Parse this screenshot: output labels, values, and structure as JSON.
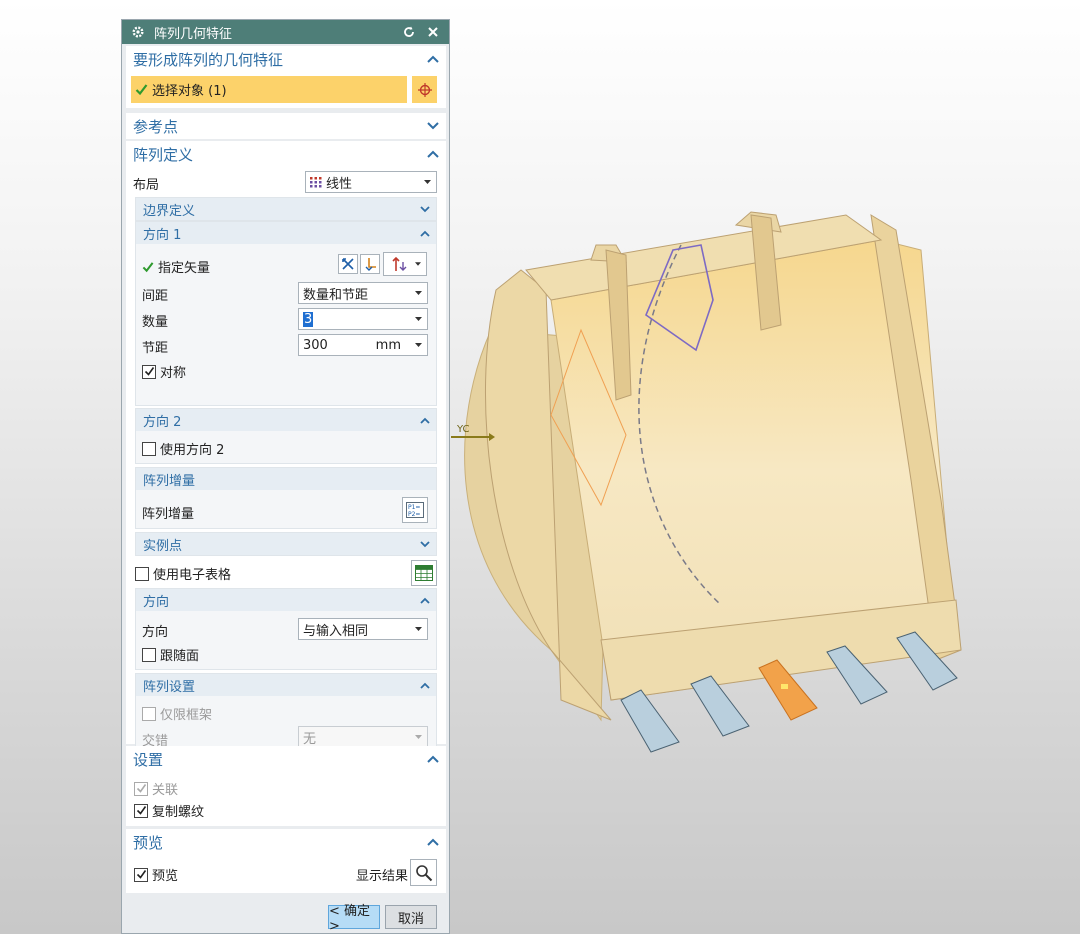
{
  "dialog": {
    "title": "阵列几何特征",
    "icons": {
      "settings": "gear-icon",
      "reset": "reset-icon",
      "close": "close-icon"
    }
  },
  "select_section": {
    "header": "要形成阵列的几何特征",
    "select_object": "选择对象 (1)"
  },
  "reference_point": {
    "header": "参考点"
  },
  "pattern_def": {
    "header": "阵列定义",
    "layout_label": "布局",
    "layout_value": "线性",
    "boundary_header": "边界定义",
    "direction1": {
      "header": "方向 1",
      "vector_label": "指定矢量",
      "spacing_label": "间距",
      "spacing_value": "数量和节距",
      "count_label": "数量",
      "count_value": "3",
      "pitch_label": "节距",
      "pitch_value": "300",
      "pitch_unit": "mm",
      "symmetric_label": "对称",
      "symmetric_checked": true
    },
    "direction2": {
      "header": "方向 2",
      "use_label": "使用方向 2",
      "use_checked": false
    },
    "increment": {
      "header": "阵列增量",
      "label": "阵列增量"
    },
    "instance_header": "实例点",
    "spreadsheet_label": "使用电子表格",
    "orientation": {
      "header": "方向",
      "label": "方向",
      "value": "与输入相同",
      "follow_label": "跟随面"
    },
    "pattern_settings": {
      "header": "阵列设置",
      "frame_only_label": "仅限框架",
      "stagger_label": "交错",
      "stagger_value": "无"
    }
  },
  "settings": {
    "header": "设置",
    "associative_label": "关联",
    "copy_threads_label": "复制螺纹",
    "copy_threads_checked": true
  },
  "preview": {
    "header": "预览",
    "preview_label": "预览",
    "preview_checked": true,
    "show_result_label": "显示结果"
  },
  "buttons": {
    "ok": "< 确定 >",
    "cancel": "取消"
  },
  "viewport": {
    "axis_label": "YC"
  },
  "colors": {
    "title_bar": "#4e7e78",
    "header_text": "#2f6ea5",
    "selection": "#fcd26a",
    "highlight_tooth": "#f2a24a"
  }
}
